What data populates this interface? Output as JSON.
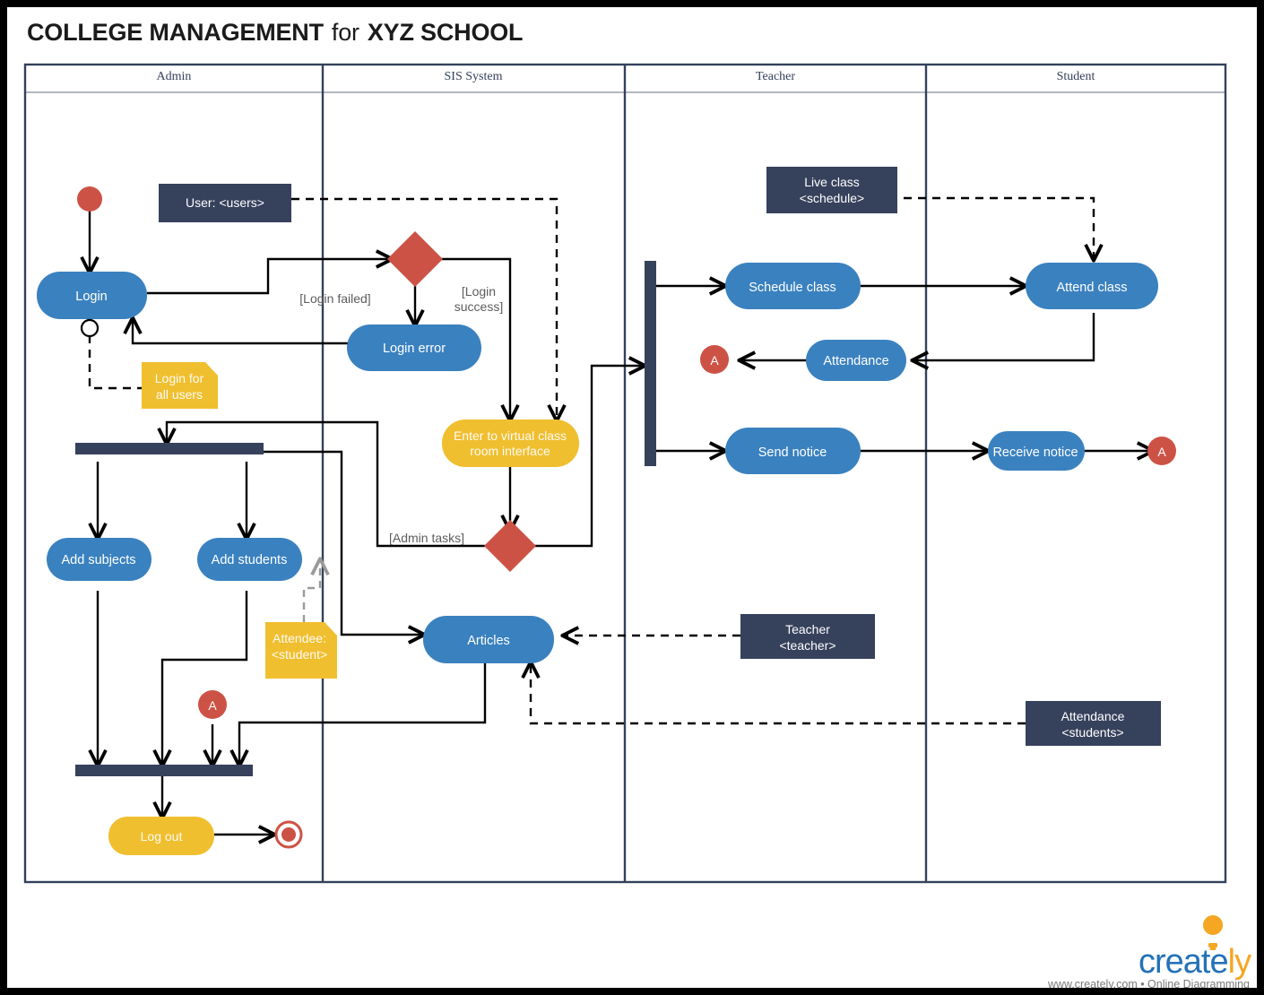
{
  "page": {
    "title": "COLLEGE MANAGEMENT for XYZ SCHOOL",
    "title_part1": "COLLEGE MANAGEMENT",
    "title_part2": "for",
    "title_part3": "XYZ SCHOOL",
    "background": "#ffffff",
    "frame_color": "#000000"
  },
  "palette": {
    "blue": "#3a81bf",
    "yellow": "#f0bf2f",
    "red": "#cd5246",
    "navy": "#36415c",
    "line": "#000000",
    "gray_line": "#9a9a9a",
    "guard_text": "#5c5c5c"
  },
  "swimlanes": [
    {
      "id": "admin",
      "label": "Admin"
    },
    {
      "id": "sis",
      "label": "SIS System"
    },
    {
      "id": "teacher",
      "label": "Teacher"
    },
    {
      "id": "student",
      "label": "Student"
    }
  ],
  "nodes": {
    "start": {
      "label": "",
      "type": "initial-node",
      "lane": "admin",
      "color": "#cd5246"
    },
    "login": {
      "label": "Login",
      "type": "activity",
      "lane": "admin",
      "color": "#3a81bf"
    },
    "login_error": {
      "label": "Login error",
      "type": "activity",
      "lane": "sis",
      "color": "#3a81bf"
    },
    "enter_vc": {
      "label": "Enter to virtual class\nroom interface",
      "line1": "Enter to virtual class",
      "line2": "room interface",
      "type": "activity",
      "lane": "sis",
      "color": "#f0bf2f"
    },
    "add_subjects": {
      "label": "Add subjects",
      "type": "activity",
      "lane": "admin",
      "color": "#3a81bf"
    },
    "add_students": {
      "label": "Add students",
      "type": "activity",
      "lane": "admin",
      "color": "#3a81bf"
    },
    "articles": {
      "label": "Articles",
      "type": "activity",
      "lane": "sis",
      "color": "#3a81bf"
    },
    "log_out": {
      "label": "Log out",
      "type": "activity",
      "lane": "admin",
      "color": "#f0bf2f"
    },
    "schedule_class": {
      "label": "Schedule class",
      "type": "activity",
      "lane": "teacher",
      "color": "#3a81bf"
    },
    "attendance": {
      "label": "Attendance",
      "type": "activity",
      "lane": "teacher",
      "color": "#3a81bf"
    },
    "send_notice": {
      "label": "Send notice",
      "type": "activity",
      "lane": "teacher",
      "color": "#3a81bf"
    },
    "attend_class": {
      "label": "Attend class",
      "type": "activity",
      "lane": "student",
      "color": "#3a81bf"
    },
    "receive_notice": {
      "label": "Receive notice",
      "type": "activity",
      "lane": "student",
      "color": "#3a81bf"
    },
    "decision_login": {
      "label": "",
      "type": "decision-node",
      "lane": "sis",
      "color": "#cd5246"
    },
    "merge_admin": {
      "label": "",
      "type": "merge-node",
      "lane": "sis",
      "color": "#cd5246"
    },
    "fork_admin": {
      "label": "",
      "type": "fork-bar",
      "lane": "admin",
      "color": "#36415c"
    },
    "join_admin": {
      "label": "",
      "type": "join-bar",
      "lane": "admin",
      "color": "#36415c"
    },
    "fork_teacher": {
      "label": "",
      "type": "fork-bar-vertical",
      "lane": "teacher",
      "color": "#36415c"
    },
    "final": {
      "label": "",
      "type": "final-node",
      "lane": "admin",
      "color": "#cd5246"
    }
  },
  "objects": [
    {
      "id": "user_obj",
      "line1": "User: <users>",
      "line2": "",
      "lane": "admin",
      "color": "#36415c"
    },
    {
      "id": "live_class_obj",
      "line1": "Live class",
      "line2": "<schedule>",
      "lane": "teacher",
      "color": "#36415c"
    },
    {
      "id": "teacher_obj",
      "line1": "Teacher",
      "line2": "<teacher>",
      "lane": "teacher",
      "color": "#36415c"
    },
    {
      "id": "attendance_obj",
      "line1": "Attendance",
      "line2": "<students>",
      "lane": "student",
      "color": "#36415c"
    }
  ],
  "notes": [
    {
      "id": "note_login",
      "line1": "Login for",
      "line2": "all users",
      "lane": "admin",
      "color": "#f0bf2f"
    },
    {
      "id": "note_attendee",
      "line1": "Attendee:",
      "line2": "<student>",
      "lane": "admin",
      "color": "#f0bf2f"
    }
  ],
  "connectors": [
    {
      "id": "conn_a_teacher",
      "label": "A",
      "lane": "teacher",
      "color": "#cd5246"
    },
    {
      "id": "conn_a_student",
      "label": "A",
      "lane": "student",
      "color": "#cd5246"
    },
    {
      "id": "conn_a_admin",
      "label": "A",
      "lane": "admin",
      "color": "#cd5246"
    }
  ],
  "guards": [
    {
      "id": "guard_failed",
      "text": "[Login failed]"
    },
    {
      "id": "guard_success_l1",
      "text": "[Login"
    },
    {
      "id": "guard_success_l2",
      "text": "success]"
    },
    {
      "id": "guard_admin",
      "text": "[Admin tasks]"
    }
  ],
  "footer": {
    "logo_part1": "creat",
    "logo_part2": "e",
    "logo_part3": "ly",
    "tagline": "www.creately.com • Online Diagramming"
  }
}
